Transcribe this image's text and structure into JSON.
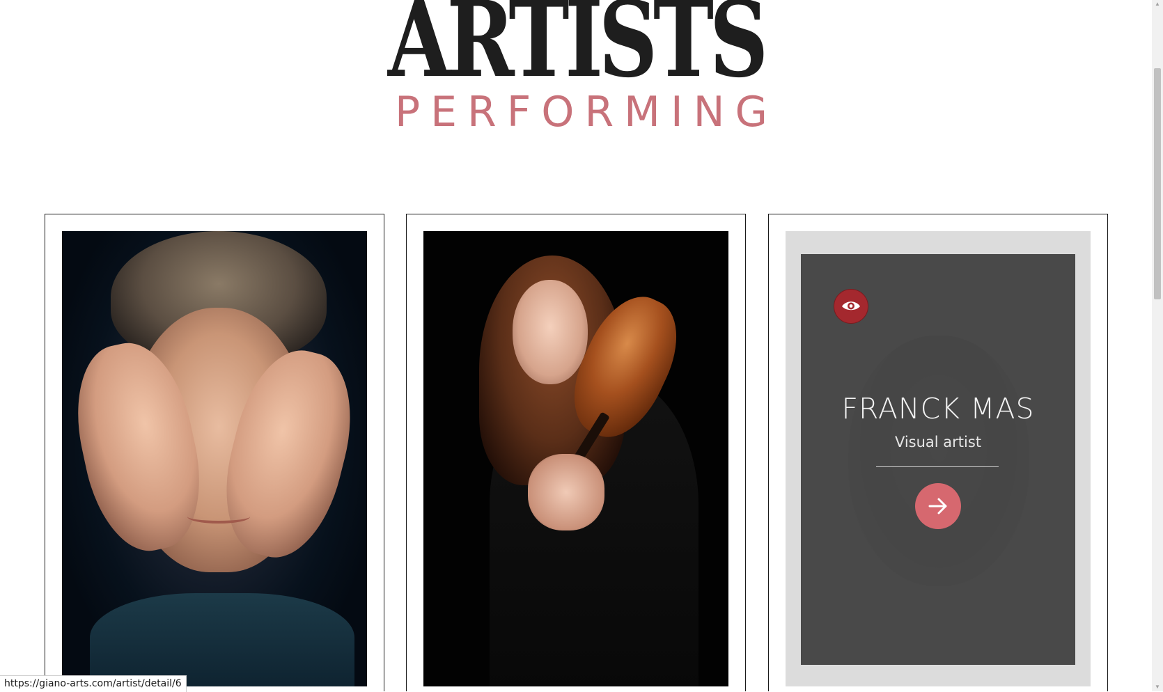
{
  "heading": {
    "title": "ARTISTS",
    "subtitle": "PERFORMING"
  },
  "cards": [
    {
      "photo": "portrait-man-hands-over-face"
    },
    {
      "photo": "portrait-woman-with-violin"
    },
    {
      "photo": "portrait-man-bald",
      "hover": {
        "badge_icon": "eye-icon",
        "name": "FRANCK MAS",
        "role": "Visual artist",
        "action_icon": "arrow-right-icon"
      }
    }
  ],
  "status_bar": {
    "url": "https://giano-arts.com/artist/detail/6"
  },
  "colors": {
    "title": "#1e1e1e",
    "subtitle": "#c8727a",
    "badge": "#a4282e",
    "arrow_button": "#d6686f",
    "overlay": "#3c3c3c"
  }
}
